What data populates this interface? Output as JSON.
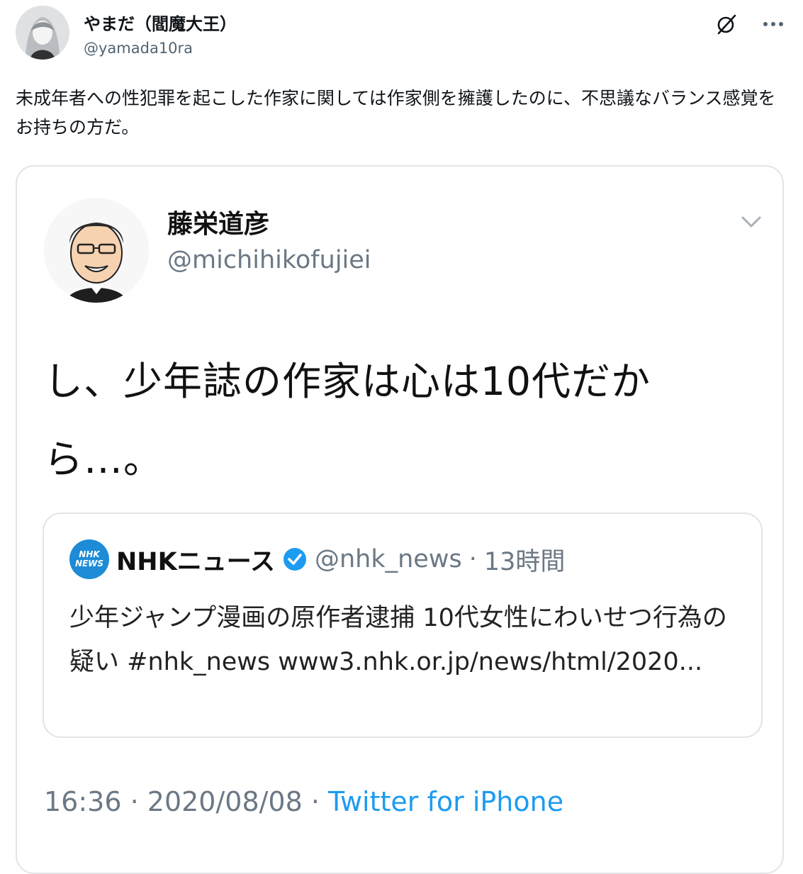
{
  "tweet": {
    "author_name": "やまだ（閻魔大王）",
    "author_handle": "@yamada10ra",
    "text": "未成年者への性犯罪を起こした作家に関しては作家側を擁護したのに、不思議なバランス感覚をお持ちの方だ。",
    "icons": [
      "grok-icon",
      "more-icon"
    ]
  },
  "embedded_tweet": {
    "author_name": "藤栄道彦",
    "author_handle": "@michihikofujiei",
    "text": "し、少年誌の作家は心は10代だから…。",
    "quoted": {
      "logo_text_top": "NHK",
      "logo_text_bottom": "NEWS",
      "author_name": "NHKニュース",
      "author_handle": "@nhk_news",
      "separator": "·",
      "time_ago": "13時間",
      "text": "少年ジャンプ漫画の原作者逮捕 10代女性にわいせつ行為の疑い #nhk_news www3.nhk.or.jp/news/html/2020..."
    },
    "time": "16:36",
    "sep1": " · ",
    "date": "2020/08/08",
    "sep2": " · ",
    "source": "Twitter for iPhone"
  },
  "colors": {
    "accent": "#1d9bf0",
    "nhk_blue": "#1d8bd6",
    "muted": "#536471",
    "border": "#e1e4e6"
  }
}
